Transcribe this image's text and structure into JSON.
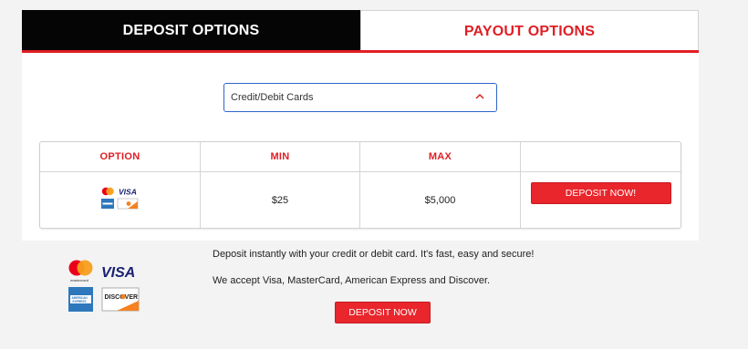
{
  "tabs": {
    "deposit_label": "DEPOSIT OPTIONS",
    "payout_label": "PAYOUT OPTIONS"
  },
  "method_select": {
    "value": "Credit/Debit Cards"
  },
  "table": {
    "headers": [
      "OPTION",
      "MIN",
      "MAX",
      ""
    ],
    "rows": [
      {
        "min": "$25",
        "max": "$5,000",
        "action_label": "DEPOSIT NOW!"
      }
    ]
  },
  "cards": {
    "visa_text": "VISA",
    "mastercard_text": "mastercard",
    "amex_text": "AMERICAN EXPRESS",
    "discover_text": "DISCOVER"
  },
  "info": {
    "line1": "Deposit instantly with your credit or debit card. It's fast, easy and secure!",
    "line2": "We accept Visa, MasterCard, American Express and Discover.",
    "button_label": "DEPOSIT NOW"
  },
  "colors": {
    "accent_red": "#e01e24",
    "active_tab_bg": "#050505",
    "select_border": "#2f64c8"
  }
}
